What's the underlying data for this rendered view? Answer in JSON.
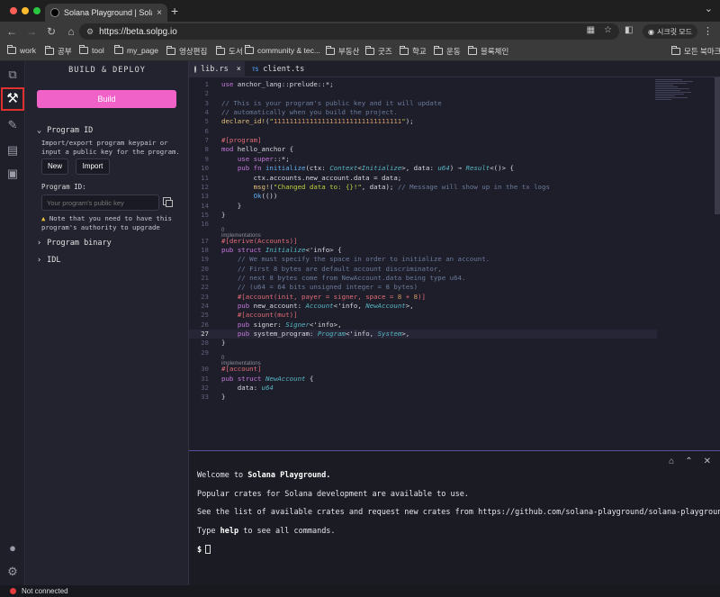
{
  "browser": {
    "tab_title": "Solana Playground | Solana IDE",
    "url": "https://beta.solpg.io",
    "incognito_label": "시크릿 모드",
    "bookmarks": [
      "work",
      "공부",
      "tool",
      "my_page",
      "영상편집",
      "도서",
      "community & tec...",
      "부동산",
      "굿즈",
      "학교",
      "운동",
      "블록체인"
    ],
    "other_bookmarks": "모든 북마크"
  },
  "sidebar": {
    "title": "BUILD & DEPLOY",
    "build_label": "Build",
    "program_id": {
      "heading": "Program ID",
      "description": "Import/export program keypair or input a public key for the program.",
      "new_label": "New",
      "import_label": "Import",
      "field_label": "Program ID:",
      "placeholder": "Your program's public key",
      "warning": "Note that you need to have this program's authority to upgrade"
    },
    "program_binary": "Program binary",
    "idl": "IDL"
  },
  "editor": {
    "tabs": [
      {
        "label": "lib.rs",
        "close": "×"
      },
      {
        "label": "client.ts",
        "badge": "TS"
      }
    ],
    "current_line": 27,
    "impl_hint": "0 implementations",
    "lines": [
      {
        "n": 1,
        "code": "use anchor_lang::prelude::*;"
      },
      {
        "n": 2,
        "code": ""
      },
      {
        "n": 3,
        "code": "// This is your program's public key and it will update"
      },
      {
        "n": 4,
        "code": "// automatically when you build the project."
      },
      {
        "n": 5,
        "code": "declare_id!(\"11111111111111111111111111111111\");"
      },
      {
        "n": 6,
        "code": ""
      },
      {
        "n": 7,
        "code": "#[program]"
      },
      {
        "n": 8,
        "code": "mod hello_anchor {"
      },
      {
        "n": 9,
        "code": "    use super::*;"
      },
      {
        "n": 10,
        "code": "    pub fn initialize(ctx: Context<Initialize>, data: u64) → Result<()> {"
      },
      {
        "n": 11,
        "code": "        ctx.accounts.new_account.data = data;"
      },
      {
        "n": 12,
        "code": "        msg!(\"Changed data to: {}!\", data); // Message will show up in the tx logs"
      },
      {
        "n": 13,
        "code": "        Ok(())"
      },
      {
        "n": 14,
        "code": "    }"
      },
      {
        "n": 15,
        "code": "}"
      },
      {
        "n": 16,
        "code": ""
      },
      {
        "n": 17,
        "code": "#[derive(Accounts)]"
      },
      {
        "n": 18,
        "code": "pub struct Initialize<'info> {"
      },
      {
        "n": 19,
        "code": "    // We must specify the space in order to initialize an account."
      },
      {
        "n": 20,
        "code": "    // First 8 bytes are default account discriminator,"
      },
      {
        "n": 21,
        "code": "    // next 8 bytes come from NewAccount.data being type u64."
      },
      {
        "n": 22,
        "code": "    // (u64 = 64 bits unsigned integer = 8 bytes)"
      },
      {
        "n": 23,
        "code": "    #[account(init, payer = signer, space = 8 + 8)]"
      },
      {
        "n": 24,
        "code": "    pub new_account: Account<'info, NewAccount>,"
      },
      {
        "n": 25,
        "code": "    #[account(mut)]"
      },
      {
        "n": 26,
        "code": "    pub signer: Signer<'info>,"
      },
      {
        "n": 27,
        "code": "    pub system_program: Program<'info, System>,"
      },
      {
        "n": 28,
        "code": "}"
      },
      {
        "n": 29,
        "code": ""
      },
      {
        "n": 30,
        "code": "#[account]"
      },
      {
        "n": 31,
        "code": "pub struct NewAccount {"
      },
      {
        "n": 32,
        "code": "    data: u64"
      },
      {
        "n": 33,
        "code": "}"
      }
    ]
  },
  "terminal": {
    "welcome_pre": "Welcome to ",
    "welcome_bold": "Solana Playground.",
    "crates_line": "Popular crates for Solana development are available to use.",
    "list_line": "See the list of available crates and request new crates from https://github.com/solana-playground/solana-playground",
    "help_pre": "Type ",
    "help_bold": "help",
    "help_post": " to see all commands.",
    "prompt": "$"
  },
  "status": {
    "connection": "Not connected",
    "indicator_color": "#e53b3b"
  },
  "colors": {
    "accent": "#f062c8",
    "highlight": "#e03030"
  }
}
